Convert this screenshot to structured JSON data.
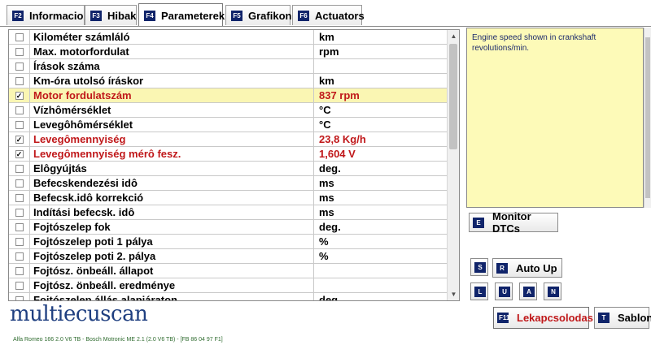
{
  "tabs": [
    {
      "key": "F2",
      "label": "Informacio",
      "active": false
    },
    {
      "key": "F3",
      "label": "Hibak",
      "active": false
    },
    {
      "key": "F4",
      "label": "Parameterek",
      "active": true
    },
    {
      "key": "F5",
      "label": "Grafikon",
      "active": false
    },
    {
      "key": "F6",
      "label": "Actuators",
      "active": false
    }
  ],
  "table": {
    "rows": [
      {
        "checked": false,
        "name": "Kilométer számláló",
        "value": "km"
      },
      {
        "checked": false,
        "name": "Max. motorfordulat",
        "value": "rpm"
      },
      {
        "checked": false,
        "name": "Írások száma",
        "value": ""
      },
      {
        "checked": false,
        "name": "Km-óra utolsó íráskor",
        "value": "km"
      },
      {
        "checked": true,
        "name": "Motor fordulatszám",
        "value": "837 rpm",
        "highlight": true,
        "selected": true
      },
      {
        "checked": false,
        "name": "Vízhômérséklet",
        "value": "°C"
      },
      {
        "checked": false,
        "name": "Levegôhômérséklet",
        "value": "°C"
      },
      {
        "checked": true,
        "name": "Levegômennyiség",
        "value": "23,8 Kg/h",
        "highlight": true
      },
      {
        "checked": true,
        "name": "Levegômennyiség mérô fesz.",
        "value": "1,604 V",
        "highlight": true
      },
      {
        "checked": false,
        "name": "Elôgyújtás",
        "value": "deg."
      },
      {
        "checked": false,
        "name": "Befecskendezési idô",
        "value": "ms"
      },
      {
        "checked": false,
        "name": "Befecsk.idô korrekció",
        "value": "ms"
      },
      {
        "checked": false,
        "name": "Indítási befecsk. idô",
        "value": "ms"
      },
      {
        "checked": false,
        "name": "Fojtószelep fok",
        "value": "deg."
      },
      {
        "checked": false,
        "name": "Fojtószelep poti 1 pálya",
        "value": "%"
      },
      {
        "checked": false,
        "name": "Fojtószelep poti 2. pálya",
        "value": "%"
      },
      {
        "checked": false,
        "name": "Fojtósz. önbeáll. állapot",
        "value": ""
      },
      {
        "checked": false,
        "name": "Fojtósz. önbeáll. eredménye",
        "value": ""
      },
      {
        "checked": false,
        "name": "Fojtószelep állás alapjáraton",
        "value": "deg."
      }
    ],
    "check_mark": "✓"
  },
  "description": {
    "text": "Engine speed shown in crankshaft revolutions/min."
  },
  "buttons": {
    "monitor_dtcs": {
      "key": "E",
      "label": "Monitor DTCs"
    },
    "s": {
      "key": "S"
    },
    "auto_up": {
      "key": "R",
      "label": "Auto Up"
    },
    "l": {
      "key": "L"
    },
    "u": {
      "key": "U"
    },
    "a": {
      "key": "A"
    },
    "n": {
      "key": "N"
    },
    "lekapcsolodas": {
      "key": "F11",
      "label": "Lekapcsolodas"
    },
    "sablon": {
      "key": "T",
      "label": "Sablon"
    }
  },
  "logo": "multiecuscan",
  "status_bar": "Alfa Romeo 166 2.0 V6 TB - Bosch Motronic ME 2.1 (2.0 V6 TB) - [FB 86 04 97 F1]",
  "colors": {
    "highlight_text": "#c0181a",
    "selected_row": "#faf6b3",
    "key_badge": "#10246a",
    "logo": "#1f3f80",
    "description_bg": "#fdfab8"
  }
}
